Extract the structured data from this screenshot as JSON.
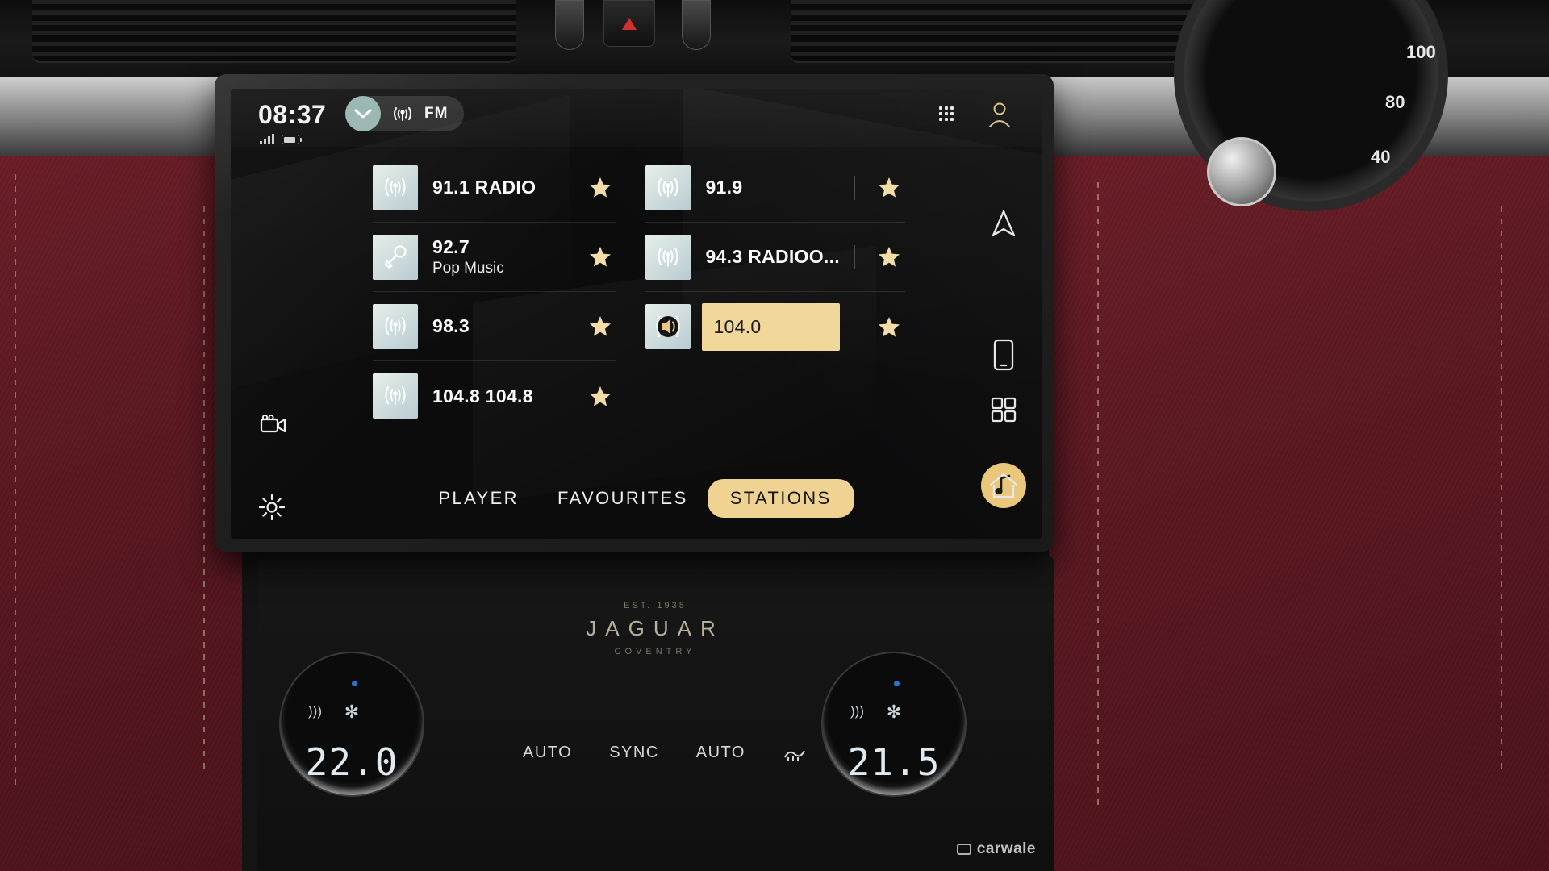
{
  "vehicle": {
    "brand_badge": {
      "est": "EST. 1935",
      "name": "JAGUAR",
      "city": "COVENTRY"
    },
    "climate": {
      "left_temp": "22.0",
      "right_temp": "21.5",
      "buttons": [
        "AUTO",
        "SYNC",
        "AUTO"
      ],
      "defrost_icon": "defrost-icon"
    },
    "gauge_numbers": [
      "100",
      "80",
      "40"
    ],
    "watermark": "carwale"
  },
  "status_bar": {
    "clock": "08:37",
    "signal_icon": "signal-bars-icon",
    "battery_icon": "battery-icon",
    "chevron_icon": "chevron-down-icon",
    "source_icon": "radio-waves-icon",
    "source_label": "FM",
    "apps_icon": "apps-grid-icon",
    "profile_icon": "user-profile-icon"
  },
  "stations": {
    "left_column": [
      {
        "icon": "radio-tower-icon",
        "name": "91.1 RADIO",
        "sub": "",
        "favourite": true,
        "active": false
      },
      {
        "icon": "microphone-icon",
        "name": "92.7",
        "sub": "Pop Music",
        "favourite": true,
        "active": false
      },
      {
        "icon": "radio-tower-icon",
        "name": "98.3",
        "sub": "",
        "favourite": true,
        "active": false
      },
      {
        "icon": "radio-tower-icon",
        "name": "104.8 104.8",
        "sub": "",
        "favourite": true,
        "active": false
      }
    ],
    "right_column": [
      {
        "icon": "radio-tower-icon",
        "name": "91.9",
        "sub": "",
        "favourite": true,
        "active": false
      },
      {
        "icon": "radio-tower-icon",
        "name": "94.3 RADIOO...",
        "sub": "",
        "favourite": true,
        "active": false
      },
      {
        "icon": "speaker-playing-icon",
        "name": "104.0",
        "sub": "",
        "favourite": true,
        "active": true
      }
    ]
  },
  "tabs": [
    {
      "label": "PLAYER",
      "active": false
    },
    {
      "label": "FAVOURITES",
      "active": false
    },
    {
      "label": "STATIONS",
      "active": true
    }
  ],
  "screen_rails": {
    "left_top_icon": "media-camera-icon",
    "left_bottom_icon": "settings-gear-icon"
  },
  "side_rail": [
    {
      "icon": "navigation-arrow-icon",
      "accent": false
    },
    {
      "icon": "phone-projection-icon",
      "accent": false
    },
    {
      "icon": "music-note-icon",
      "accent": true
    },
    {
      "icon": "apps-squares-icon",
      "accent": false
    },
    {
      "icon": "home-icon",
      "accent": false
    }
  ],
  "colors": {
    "accent_gold": "#f0d392",
    "highlight_gold": "#f2d79a",
    "star_gold": "#f3dca6",
    "screen_bg": "#0c0c0d",
    "chevron_teal": "#9cb8b4",
    "leather_red": "#5c1821"
  }
}
